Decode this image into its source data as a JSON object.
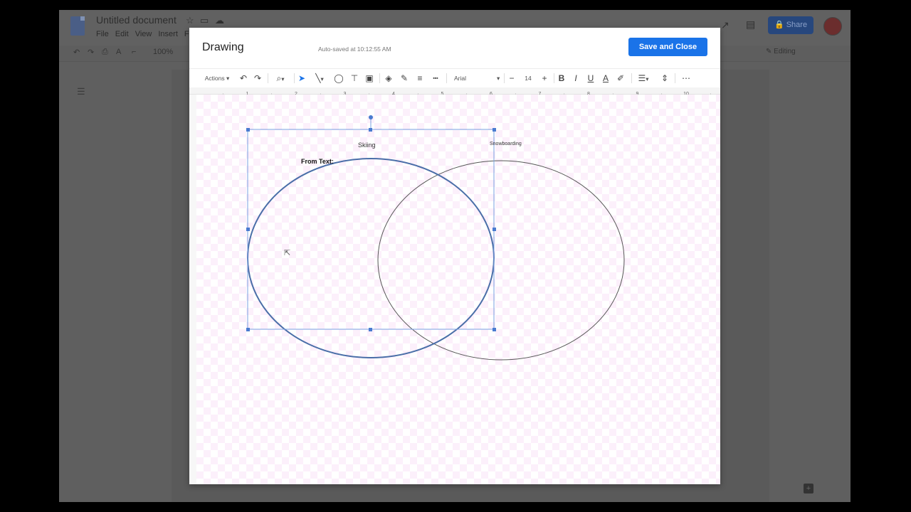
{
  "docs": {
    "title": "Untitled document",
    "menu": [
      "File",
      "Edit",
      "View",
      "Insert",
      "F"
    ],
    "zoom": "100%",
    "share_label": "Share",
    "editing_label": "Editing"
  },
  "dialog": {
    "title": "Drawing",
    "autosave": "Auto-saved at 10:12:55 AM",
    "save_close_label": "Save and Close"
  },
  "toolbar": {
    "actions_label": "Actions",
    "font": "Arial",
    "font_size": "14",
    "bold": "B",
    "italic": "I",
    "underline": "U",
    "text_color": "A"
  },
  "ruler": {
    "marks": [
      "1",
      "2",
      "3",
      "4",
      "5",
      "6",
      "7",
      "8",
      "9",
      "10"
    ]
  },
  "drawing": {
    "left_label": "Skiing",
    "right_label": "Snowboarding",
    "note_label": "From Text:"
  },
  "colors": {
    "accent": "#1a73e8",
    "selection": "#4a7bd0"
  }
}
